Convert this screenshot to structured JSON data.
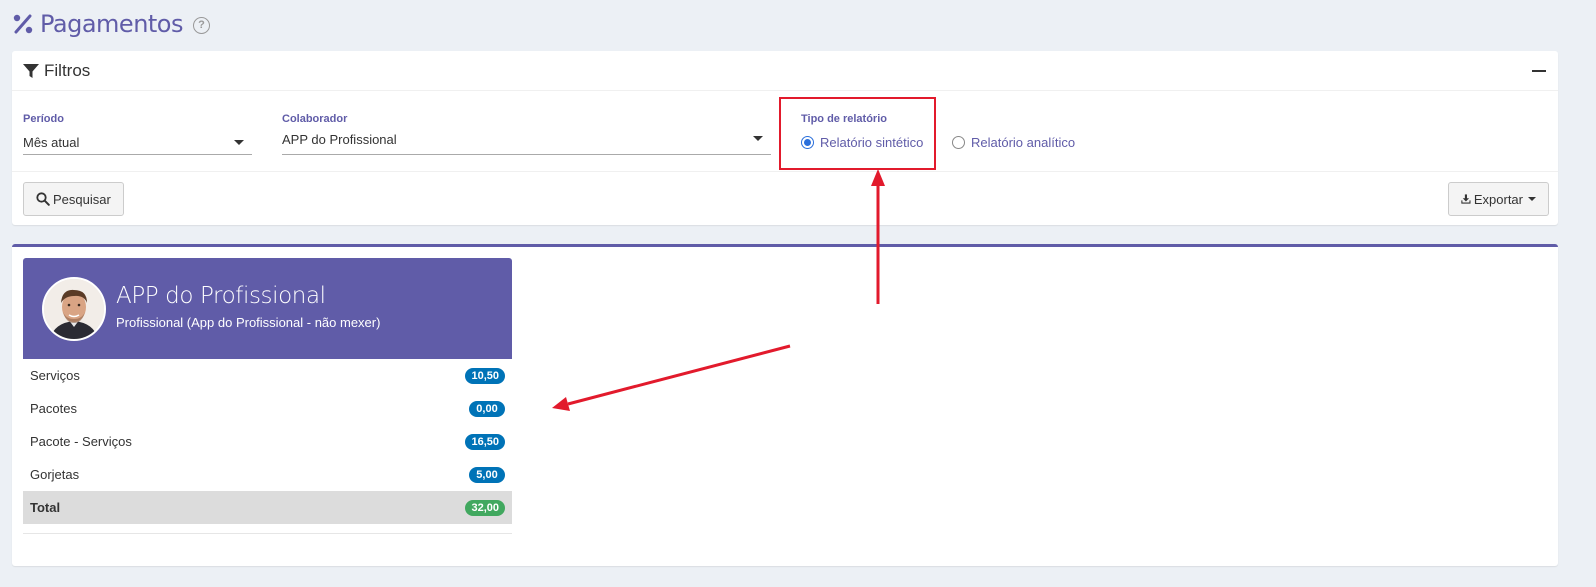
{
  "page": {
    "title": "Pagamentos",
    "title_icon": "percent-icon",
    "help_icon": "question-circle-icon"
  },
  "filters": {
    "title": "Filtros",
    "periodo": {
      "label": "Período",
      "value": "Mês atual"
    },
    "colaborador": {
      "label": "Colaborador",
      "value": "APP do Profissional"
    },
    "tipo_relatorio": {
      "label": "Tipo de relatório",
      "options": [
        {
          "label": "Relatório sintético",
          "checked": true
        },
        {
          "label": "Relatório analítico",
          "checked": false
        }
      ]
    },
    "search_button": "Pesquisar",
    "export_button": "Exportar"
  },
  "widget": {
    "name": "APP do Profissional",
    "description": "Profissional (App do Profissional - não mexer)",
    "rows": [
      {
        "label": "Serviços",
        "value": "10,50"
      },
      {
        "label": "Pacotes",
        "value": "0,00"
      },
      {
        "label": "Pacote - Serviços",
        "value": "16,50"
      },
      {
        "label": "Gorjetas",
        "value": "5,00"
      }
    ],
    "total": {
      "label": "Total",
      "value": "32,00"
    }
  },
  "colors": {
    "accent": "#605ca8",
    "badge_blue": "#0073b7",
    "badge_green": "#41a85f",
    "annotation_red": "#e21a2c"
  }
}
